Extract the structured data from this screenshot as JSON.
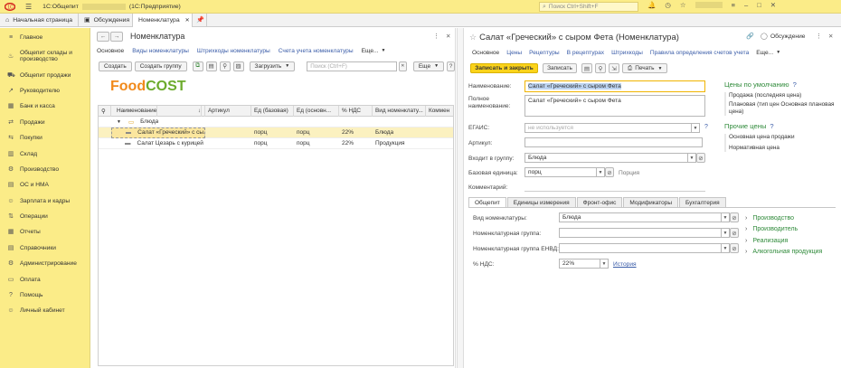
{
  "titlebar": {
    "app_title": "1С:Общепит",
    "db_name": "(1С:Предприятие)",
    "search_placeholder": "Поиск Ctrl+Shift+F"
  },
  "tabs": [
    {
      "label": "Начальная страница"
    },
    {
      "label": "Обсуждения"
    },
    {
      "label": "Номенклатура"
    }
  ],
  "sidebar": {
    "items": [
      {
        "label": "Главное",
        "icon": "menu-icon"
      },
      {
        "label": "Общепит склады и производство",
        "icon": "pot-icon"
      },
      {
        "label": "Общепит продажи",
        "icon": "cart-icon"
      },
      {
        "label": "Руководителю",
        "icon": "chart-icon"
      },
      {
        "label": "Банк и касса",
        "icon": "bank-icon"
      },
      {
        "label": "Продажи",
        "icon": "sales-icon"
      },
      {
        "label": "Покупки",
        "icon": "purchase-icon"
      },
      {
        "label": "Склад",
        "icon": "warehouse-icon"
      },
      {
        "label": "Производство",
        "icon": "factory-icon"
      },
      {
        "label": "ОС и НМА",
        "icon": "assets-icon"
      },
      {
        "label": "Зарплата и кадры",
        "icon": "people-icon"
      },
      {
        "label": "Операции",
        "icon": "operations-icon"
      },
      {
        "label": "Отчеты",
        "icon": "report-icon"
      },
      {
        "label": "Справочники",
        "icon": "book-icon"
      },
      {
        "label": "Администрирование",
        "icon": "gear-icon"
      },
      {
        "label": "Оплата",
        "icon": "payment-icon"
      },
      {
        "label": "Помощь",
        "icon": "help-icon"
      },
      {
        "label": "Личный кабинет",
        "icon": "user-icon"
      }
    ]
  },
  "list": {
    "title": "Номенклатура",
    "nav": [
      "Основное",
      "Виды номенклатуры",
      "Штрихкоды номенклатуры",
      "Счета учета номенклатуры",
      "Еще..."
    ],
    "buttons": {
      "create": "Создать",
      "create_group": "Создать группу",
      "load": "Загрузить",
      "more": "Еще"
    },
    "search_placeholder": "Поиск (Ctrl+F)",
    "logo_text_a": "Food",
    "logo_text_b": "COST",
    "columns": [
      "Наименование",
      "Артикул",
      "Ед (базовая)",
      "Ед (основн...",
      "% НДС",
      "Вид номенклату...",
      "Коммен"
    ],
    "rows": [
      {
        "name": "Блюда",
        "article": "",
        "unit": "",
        "unit2": "",
        "vat": "",
        "kind": "",
        "group": true
      },
      {
        "name": "Салат «Греческий» с сы...",
        "article": "",
        "unit": "порц",
        "unit2": "порц",
        "vat": "22%",
        "kind": "Блюда",
        "group": false
      },
      {
        "name": "Салат Цезарь с курицей",
        "article": "",
        "unit": "порц",
        "unit2": "порц",
        "vat": "22%",
        "kind": "Продукция",
        "group": false
      }
    ]
  },
  "form": {
    "title": "Салат «Греческий» с сыром Фета (Номенклатура)",
    "discussion": "Обсуждение",
    "nav": [
      "Основное",
      "Цены",
      "Рецептуры",
      "В рецептурах",
      "Штрихкоды",
      "Правила определения счетов учета",
      "Еще..."
    ],
    "buttons": {
      "save_close": "Записать и закрыть",
      "save": "Записать",
      "print": "Печать",
      "more": "Еще"
    },
    "fields": {
      "name_label": "Наименование:",
      "name_value": "Салат «Греческий» с сыром Фета",
      "full_label": "Полное наименование:",
      "full_value": "Салат «Греческий» с сыром Фета",
      "egais_label": "ЕГАИС:",
      "egais_value": "не используется",
      "article_label": "Артикул:",
      "article_value": "",
      "group_label": "Входит в группу:",
      "group_value": "Блюда",
      "unit_label": "Базовая единица:",
      "unit_value": "порц",
      "portion": "Порция",
      "comment_label": "Комментарий:",
      "comment_value": ""
    },
    "subtabs": [
      "Общепит",
      "Единицы измерения",
      "Фронт-офис",
      "Модификаторы",
      "Бухгалтерия"
    ],
    "sub": {
      "kind_label": "Вид номенклатуры:",
      "kind_value": "Блюда",
      "ngroup_label": "Номенклатурная группа:",
      "ngroup_value": "",
      "envd_label": "Номенклатурная группа ЕНВД:",
      "envd_value": "",
      "vat_label": "% НДС:",
      "vat_value": "22%",
      "history": "История"
    },
    "links": [
      "Производство",
      "Производитель",
      "Реализация",
      "Алкогольная продукция"
    ],
    "prices": {
      "default_title": "Цены по умолчанию",
      "default_q": "?",
      "default_items": [
        "Продажа (последняя цена)",
        "Плановая (тип цен Основная плановая цена)"
      ],
      "other_title": "Прочие цены",
      "other_q": "?",
      "other_items": [
        "Основная цена продажи",
        "Нормативная цена"
      ]
    }
  },
  "colors": {
    "accent": "#fbec88",
    "button": "#fbd31a",
    "link": "#3a5ca8",
    "green": "#2f8a3a",
    "logo_orange": "#f18a1c",
    "logo_green": "#6cab2c"
  }
}
